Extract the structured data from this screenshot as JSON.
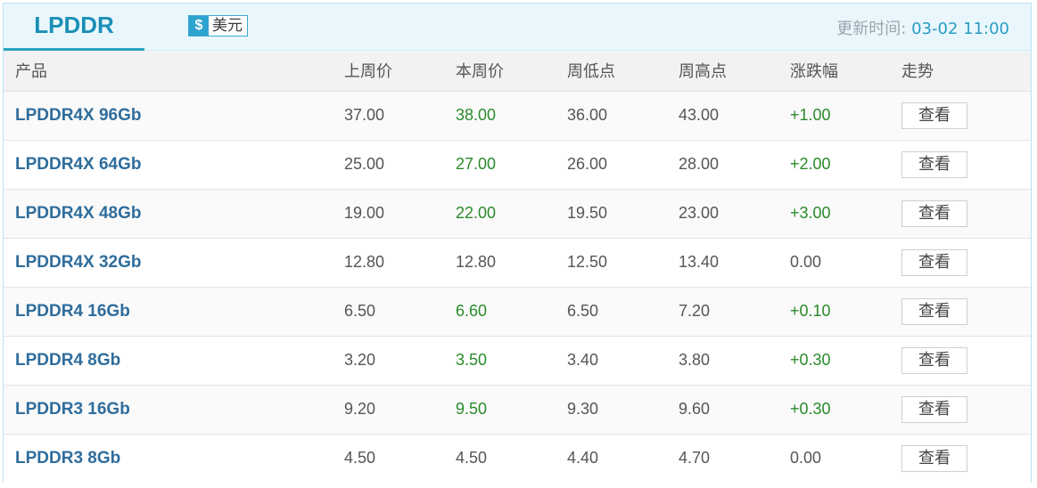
{
  "tab": {
    "label": "LPDDR"
  },
  "currency": {
    "symbol": "$",
    "label": "美元"
  },
  "updated": {
    "label": "更新时间:",
    "value": "03-02 11:00"
  },
  "table": {
    "headers": [
      "产品",
      "上周价",
      "本周价",
      "周低点",
      "周高点",
      "涨跌幅",
      "走势"
    ],
    "rows": [
      {
        "product": "LPDDR4X 96Gb",
        "last_week": "37.00",
        "this_week": "38.00",
        "week_low": "36.00",
        "week_high": "43.00",
        "change": "+1.00",
        "trend": "查看",
        "up": true
      },
      {
        "product": "LPDDR4X 64Gb",
        "last_week": "25.00",
        "this_week": "27.00",
        "week_low": "26.00",
        "week_high": "28.00",
        "change": "+2.00",
        "trend": "查看",
        "up": true
      },
      {
        "product": "LPDDR4X 48Gb",
        "last_week": "19.00",
        "this_week": "22.00",
        "week_low": "19.50",
        "week_high": "23.00",
        "change": "+3.00",
        "trend": "查看",
        "up": true
      },
      {
        "product": "LPDDR4X 32Gb",
        "last_week": "12.80",
        "this_week": "12.80",
        "week_low": "12.50",
        "week_high": "13.40",
        "change": "0.00",
        "trend": "查看",
        "up": false
      },
      {
        "product": "LPDDR4 16Gb",
        "last_week": "6.50",
        "this_week": "6.60",
        "week_low": "6.50",
        "week_high": "7.20",
        "change": "+0.10",
        "trend": "查看",
        "up": true
      },
      {
        "product": "LPDDR4 8Gb",
        "last_week": "3.20",
        "this_week": "3.50",
        "week_low": "3.40",
        "week_high": "3.80",
        "change": "+0.30",
        "trend": "查看",
        "up": true
      },
      {
        "product": "LPDDR3 16Gb",
        "last_week": "9.20",
        "this_week": "9.50",
        "week_low": "9.30",
        "week_high": "9.60",
        "change": "+0.30",
        "trend": "查看",
        "up": true
      },
      {
        "product": "LPDDR3 8Gb",
        "last_week": "4.50",
        "this_week": "4.50",
        "week_low": "4.40",
        "week_high": "4.70",
        "change": "0.00",
        "trend": "查看",
        "up": false
      }
    ]
  },
  "colors": {
    "accent": "#2ea3c4",
    "up": "#2a8a2a",
    "product": "#2f6d9c"
  }
}
